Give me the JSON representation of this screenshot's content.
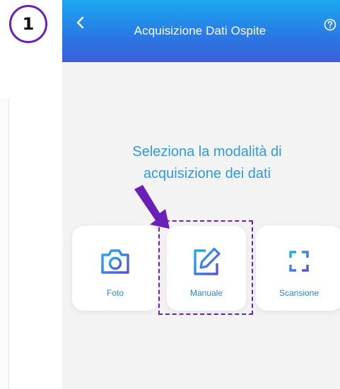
{
  "step_badge": "1",
  "header": {
    "title": "Acquisizione Dati Ospite",
    "back_icon": "chevron-left-icon",
    "help_icon": "help-circle-icon"
  },
  "prompt": {
    "line1": "Seleziona la modalità di",
    "line2": "acquisizione dei dati"
  },
  "options": [
    {
      "label": "Foto",
      "icon": "camera-icon"
    },
    {
      "label": "Manuale",
      "icon": "edit-icon"
    },
    {
      "label": "Scansione",
      "icon": "scan-icon"
    }
  ],
  "colors": {
    "header_top": "#1ba8f0",
    "header_bottom": "#3d5ed8",
    "accent_text": "#2d9bdc",
    "annotation": "#6a1fb8"
  }
}
